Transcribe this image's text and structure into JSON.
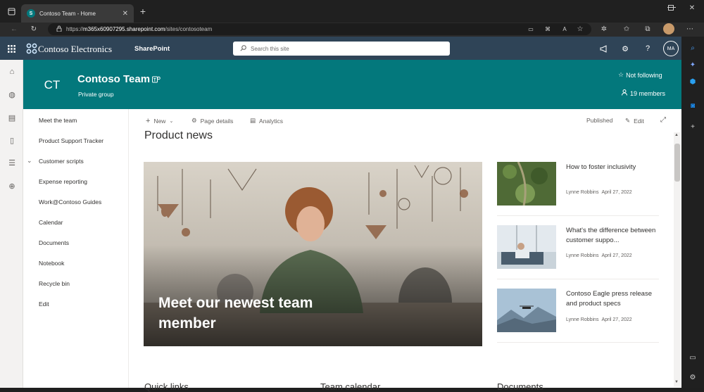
{
  "browser": {
    "tab_title": "Contoso Team - Home",
    "url_prefix": "https://",
    "url_domain": "m365x60907295.sharepoint.com",
    "url_path": "/sites/contosoteam"
  },
  "suite": {
    "org_name": "Contoso Electronics",
    "app_name": "SharePoint",
    "search_placeholder": "Search this site",
    "avatar_initials": "MA"
  },
  "site": {
    "logo_initials": "CT",
    "title": "Contoso Team",
    "privacy": "Private group",
    "follow_label": "Not following",
    "members_label": "19 members"
  },
  "nav": {
    "items": [
      {
        "label": "Meet the team"
      },
      {
        "label": "Product Support Tracker"
      },
      {
        "label": "Customer scripts"
      },
      {
        "label": "Expense reporting"
      },
      {
        "label": "Work@Contoso Guides"
      },
      {
        "label": "Calendar"
      },
      {
        "label": "Documents"
      },
      {
        "label": "Notebook"
      },
      {
        "label": "Recycle bin"
      },
      {
        "label": "Edit"
      }
    ]
  },
  "commands": {
    "new": "New",
    "page_details": "Page details",
    "analytics": "Analytics",
    "published": "Published",
    "edit": "Edit"
  },
  "news": {
    "section_title": "Product news",
    "hero_title": "Meet our newest team member",
    "items": [
      {
        "title": "How to foster inclusivity",
        "author": "Lynne Robbins",
        "date": "April 27, 2022"
      },
      {
        "title": "What's the difference between customer suppo...",
        "author": "Lynne Robbins",
        "date": "April 27, 2022"
      },
      {
        "title": "Contoso Eagle press release and product specs",
        "author": "Lynne Robbins",
        "date": "April 27, 2022"
      }
    ]
  },
  "below_sections": {
    "a": "Quick links",
    "b": "Team calendar",
    "c": "Documents"
  },
  "colors": {
    "suite_bar": "#2f4457",
    "header": "#03787c"
  }
}
